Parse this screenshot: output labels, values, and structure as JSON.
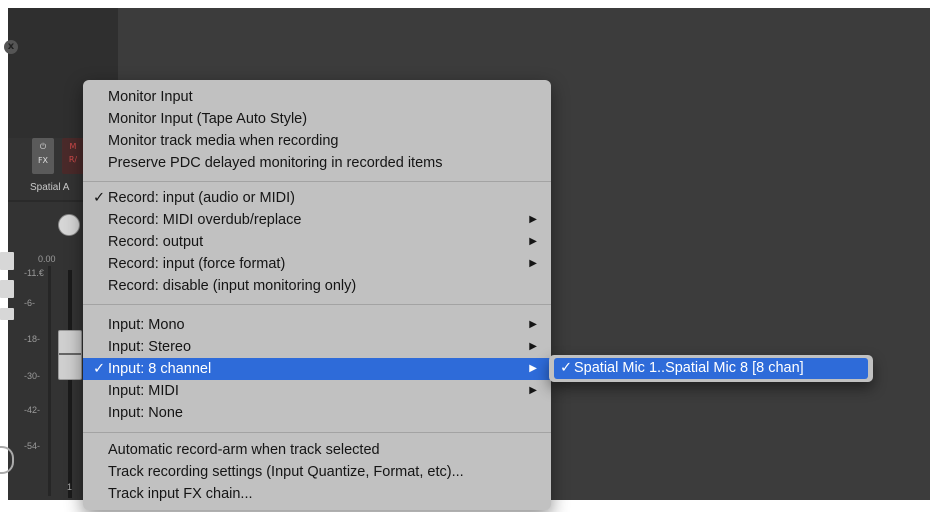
{
  "mixer": {
    "close_glyph": "x",
    "buttons": [
      {
        "top": "⏻",
        "bottom": "FX"
      },
      {
        "top": "M",
        "bottom": "R/"
      }
    ],
    "strip_name": "Spatial A",
    "volume_readout": "0.00",
    "scale_labels": [
      "-11.€",
      "-6-",
      "-18-",
      "-30-",
      "-42-",
      "-54-"
    ],
    "track_number": "1"
  },
  "menu": {
    "groups": [
      [
        {
          "label": "Monitor Input",
          "checked": false,
          "submenu": false
        },
        {
          "label": "Monitor Input (Tape Auto Style)",
          "checked": false,
          "submenu": false
        },
        {
          "label": "Monitor track media when recording",
          "checked": false,
          "submenu": false
        },
        {
          "label": "Preserve PDC delayed monitoring in recorded items",
          "checked": false,
          "submenu": false
        }
      ],
      [
        {
          "label": "Record: input (audio or MIDI)",
          "checked": true,
          "submenu": false
        },
        {
          "label": "Record: MIDI overdub/replace",
          "checked": false,
          "submenu": true
        },
        {
          "label": "Record: output",
          "checked": false,
          "submenu": true
        },
        {
          "label": "Record: input (force format)",
          "checked": false,
          "submenu": true
        },
        {
          "label": "Record: disable (input monitoring only)",
          "checked": false,
          "submenu": false
        }
      ],
      [
        {
          "label": "Input: Mono",
          "checked": false,
          "submenu": true
        },
        {
          "label": "Input: Stereo",
          "checked": false,
          "submenu": true
        },
        {
          "label": "Input: 8 channel",
          "checked": true,
          "submenu": true,
          "highlighted": true
        },
        {
          "label": "Input: MIDI",
          "checked": false,
          "submenu": true
        },
        {
          "label": "Input: None",
          "checked": false,
          "submenu": false
        }
      ],
      [
        {
          "label": "Automatic record-arm when track selected",
          "checked": false,
          "submenu": false
        },
        {
          "label": "Track recording settings (Input Quantize, Format, etc)...",
          "checked": false,
          "submenu": false
        },
        {
          "label": "Track input FX chain...",
          "checked": false,
          "submenu": false
        }
      ]
    ],
    "check_glyph": "✓",
    "arrow_glyph": "▶"
  },
  "submenu": {
    "item": {
      "label": "Spatial Mic 1..Spatial Mic 8 [8 chan]",
      "checked": true
    }
  },
  "colors": {
    "highlight": "#2e6bd9",
    "menu_bg": "#c1c1c1",
    "daw_bg": "#3c3c3c"
  }
}
